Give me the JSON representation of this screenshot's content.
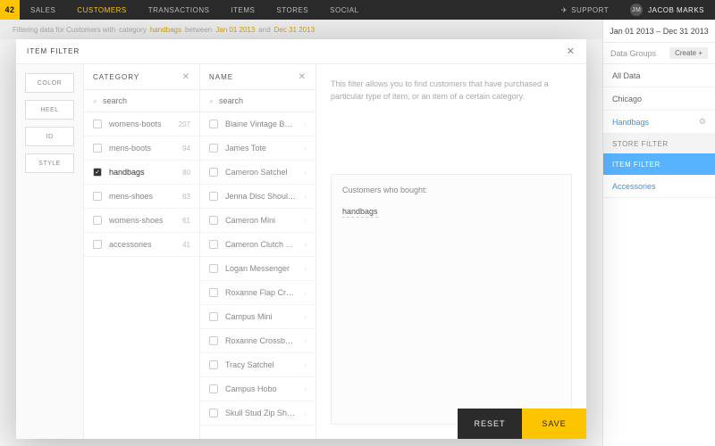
{
  "brand": "42",
  "nav": [
    "SALES",
    "CUSTOMERS",
    "TRANSACTIONS",
    "ITEMS",
    "STORES",
    "SOCIAL"
  ],
  "nav_active": 1,
  "support": "SUPPORT",
  "user": "JACOB MARKS",
  "filterbar": {
    "prefix": "Filtering data for Customers with",
    "cat": "category",
    "val": "handbags",
    "bw": "between",
    "d1": "Jan 01 2013",
    "and": "and",
    "d2": "Dec 31 2013"
  },
  "rightpanel": {
    "daterange": "Jan 01 2013 – Dec 31 2013",
    "data_groups_label": "Data Groups",
    "create": "Create  +",
    "items": [
      "All Data",
      "Chicago"
    ],
    "active_link": "Handbags",
    "store_filter": "STORE FILTER",
    "item_filter": "ITEM FILTER",
    "accessories": "Accessories"
  },
  "modal": {
    "title": "ITEM FILTER",
    "chips": [
      "COLOR",
      "HEEL",
      "ID",
      "STYLE"
    ],
    "category": {
      "title": "CATEGORY",
      "search": "search",
      "items": [
        {
          "label": "womens-boots",
          "count": "207"
        },
        {
          "label": "mens-boots",
          "count": "94"
        },
        {
          "label": "handbags",
          "count": "80",
          "selected": true
        },
        {
          "label": "mens-shoes",
          "count": "63"
        },
        {
          "label": "womens-shoes",
          "count": "61"
        },
        {
          "label": "accessories",
          "count": "41"
        }
      ]
    },
    "name": {
      "title": "NAME",
      "search": "search",
      "items": [
        {
          "label": "Blaine Vintage Back Pack"
        },
        {
          "label": "James Tote"
        },
        {
          "label": "Cameron Satchel"
        },
        {
          "label": "Jenna Disc Shoulder"
        },
        {
          "label": "Cameron Mini"
        },
        {
          "label": "Cameron Clutch Crossbo…"
        },
        {
          "label": "Logan Messenger"
        },
        {
          "label": "Roxanne Flap Crossbody"
        },
        {
          "label": "Campus Mini"
        },
        {
          "label": "Roxanne Crossbody"
        },
        {
          "label": "Tracy Satchel"
        },
        {
          "label": "Campus Hobo"
        },
        {
          "label": "Skull Stud Zip Shoulder"
        }
      ]
    },
    "description": "This filter allows you to find customers that have purchased a particular type of item, or an item of a certain category.",
    "bought_label": "Customers who bought:",
    "bought_tag": "handbags",
    "reset": "RESET",
    "save": "SAVE"
  }
}
